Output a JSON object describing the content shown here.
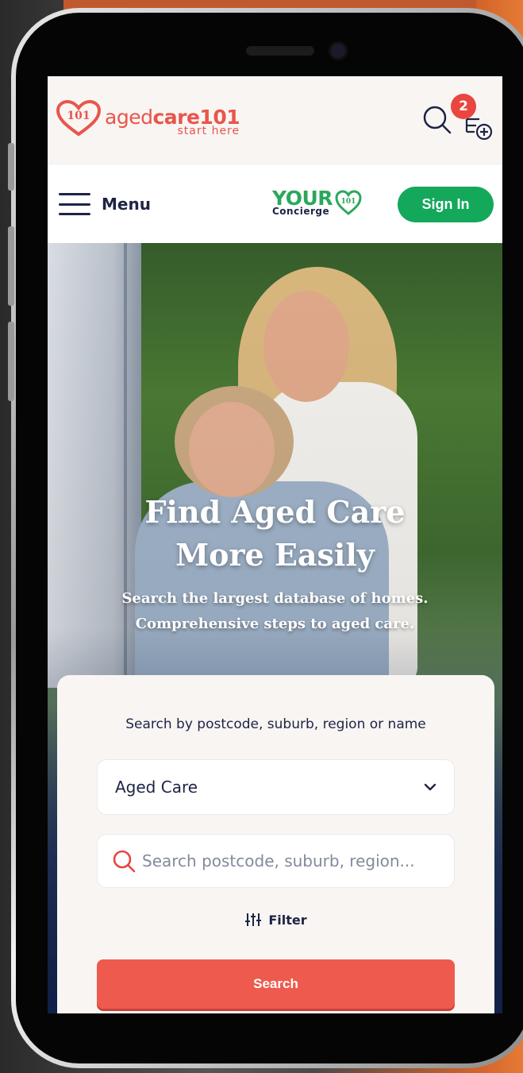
{
  "header": {
    "logo_prefix": "aged",
    "logo_bold": "care101",
    "logo_tagline": "start here",
    "logo_heart_text": "101",
    "cart_count": "2"
  },
  "nav": {
    "menu_label": "Menu",
    "concierge_main": "YOUR",
    "concierge_sub": "Concierge",
    "concierge_heart_text": "101",
    "signin_label": "Sign In"
  },
  "hero": {
    "title_line1": "Find Aged Care",
    "title_line2": "More Easily",
    "subtitle_line1": "Search the largest database of homes.",
    "subtitle_line2": "Comprehensive steps to aged care."
  },
  "search_card": {
    "label": "Search by postcode, suburb, region or name",
    "care_type_value": "Aged Care",
    "search_placeholder": "Search postcode, suburb, region...",
    "filter_label": "Filter",
    "search_button_label": "Search"
  },
  "colors": {
    "brand_red": "#e8564b",
    "brand_green": "#14a85a",
    "navy": "#1d2445",
    "button_red": "#ee5a4d"
  }
}
